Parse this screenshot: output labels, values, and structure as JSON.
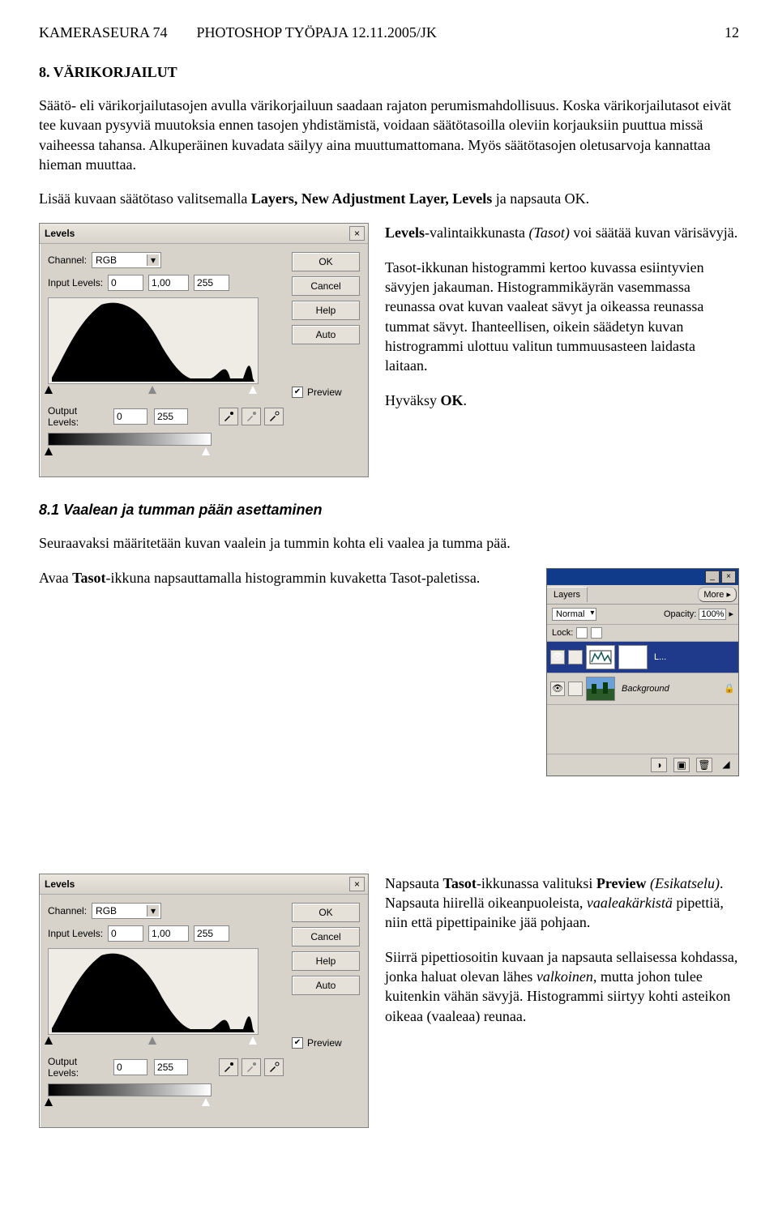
{
  "header": {
    "left": "KAMERASEURA 74        PHOTOSHOP TYÖPAJA 12.11.2005/JK",
    "right": "12"
  },
  "section": {
    "title": "8. VÄRIKORJAILUT",
    "p1": "Säätö- eli värikorjailutasojen avulla värikorjailuun saadaan rajaton perumismahdollisuus. Koska värikorjailutasot eivät tee kuvaan pysyviä muutoksia ennen tasojen yhdistämistä, voidaan säätötasoilla oleviin korjauksiin puuttua missä vaiheessa tahansa. Alkuperäinen kuvadata säilyy aina muuttumattomana. Myös säätötasojen oletusarvoja kannattaa hieman muuttaa.",
    "p2_pre": "Lisää kuvaan säätötaso valitsemalla ",
    "p2_b": "Layers, New Adjustment Layer, Levels",
    "p2_post": " ja napsauta OK."
  },
  "levels": {
    "title": "Levels",
    "close": "×",
    "channel_label": "Channel:",
    "channel_value": "RGB",
    "input_label": "Input Levels:",
    "input_v1": "0",
    "input_v2": "1,00",
    "input_v3": "255",
    "output_label": "Output Levels:",
    "output_v1": "0",
    "output_v2": "255",
    "ok": "OK",
    "cancel": "Cancel",
    "help": "Help",
    "auto": "Auto",
    "preview": "Preview",
    "check": "✔"
  },
  "sideA": {
    "p1_b": "Levels",
    "p1_rest": "-valintaikkunasta ",
    "p1_i": "(Tasot)",
    "p1_tail": " voi säätää kuvan värisävyjä.",
    "p2": "Tasot-ikkunan histogrammi kertoo kuvassa esiintyvien sävyjen jakauman. Histogrammikäyrän vasemmassa reunassa ovat kuvan vaaleat sävyt ja oikeassa reunassa tummat sävyt. Ihanteellisen, oikein säädetyn kuvan histrogrammi ulottuu valitun tummuusasteen laidasta laitaan.",
    "p3_pre": "Hyväksy ",
    "p3_b": "OK",
    "p3_post": "."
  },
  "sub": {
    "title": "8.1 Vaalean ja tumman pään asettaminen",
    "p1": "Seuraavaksi määritetään kuvan vaalein ja tummin kohta eli vaalea ja tumma pää.",
    "p2_pre": "Avaa ",
    "p2_b": "Tasot",
    "p2_post": "-ikkuna napsauttamalla histogrammin kuvaketta Tasot-paletissa."
  },
  "layers": {
    "tab": "Layers",
    "more": "More ▸",
    "mode": "Normal",
    "opacity_label": "Opacity:",
    "opacity_value": "100%",
    "lock_label": "Lock:",
    "layer1": "L...",
    "layer2": "Background",
    "lock_icon": "🔒",
    "eye": "👁"
  },
  "sideB": {
    "p1_a": "Napsauta ",
    "p1_b1": "Tasot",
    "p1_mid": "-ikkunassa valituksi ",
    "p1_b2": "Preview",
    "p1_nl": " ",
    "p1_i": "(Esikatselu)",
    "p1_c": ". Napsauta hiirellä oikeanpuoleista, ",
    "p1_i2": "vaaleakärkistä",
    "p1_d": " pipettiä, niin että pipettipainike jää pohjaan.",
    "p2_a": "Siirrä pipettiosoitin kuvaan ja napsauta sellaisessa kohdassa, jonka haluat olevan lähes ",
    "p2_i": "valkoinen",
    "p2_b": ", mutta johon tulee kuitenkin vähän sävyjä. Histogrammi siirtyy kohti asteikon oikeaa (vaaleaa) reunaa."
  }
}
